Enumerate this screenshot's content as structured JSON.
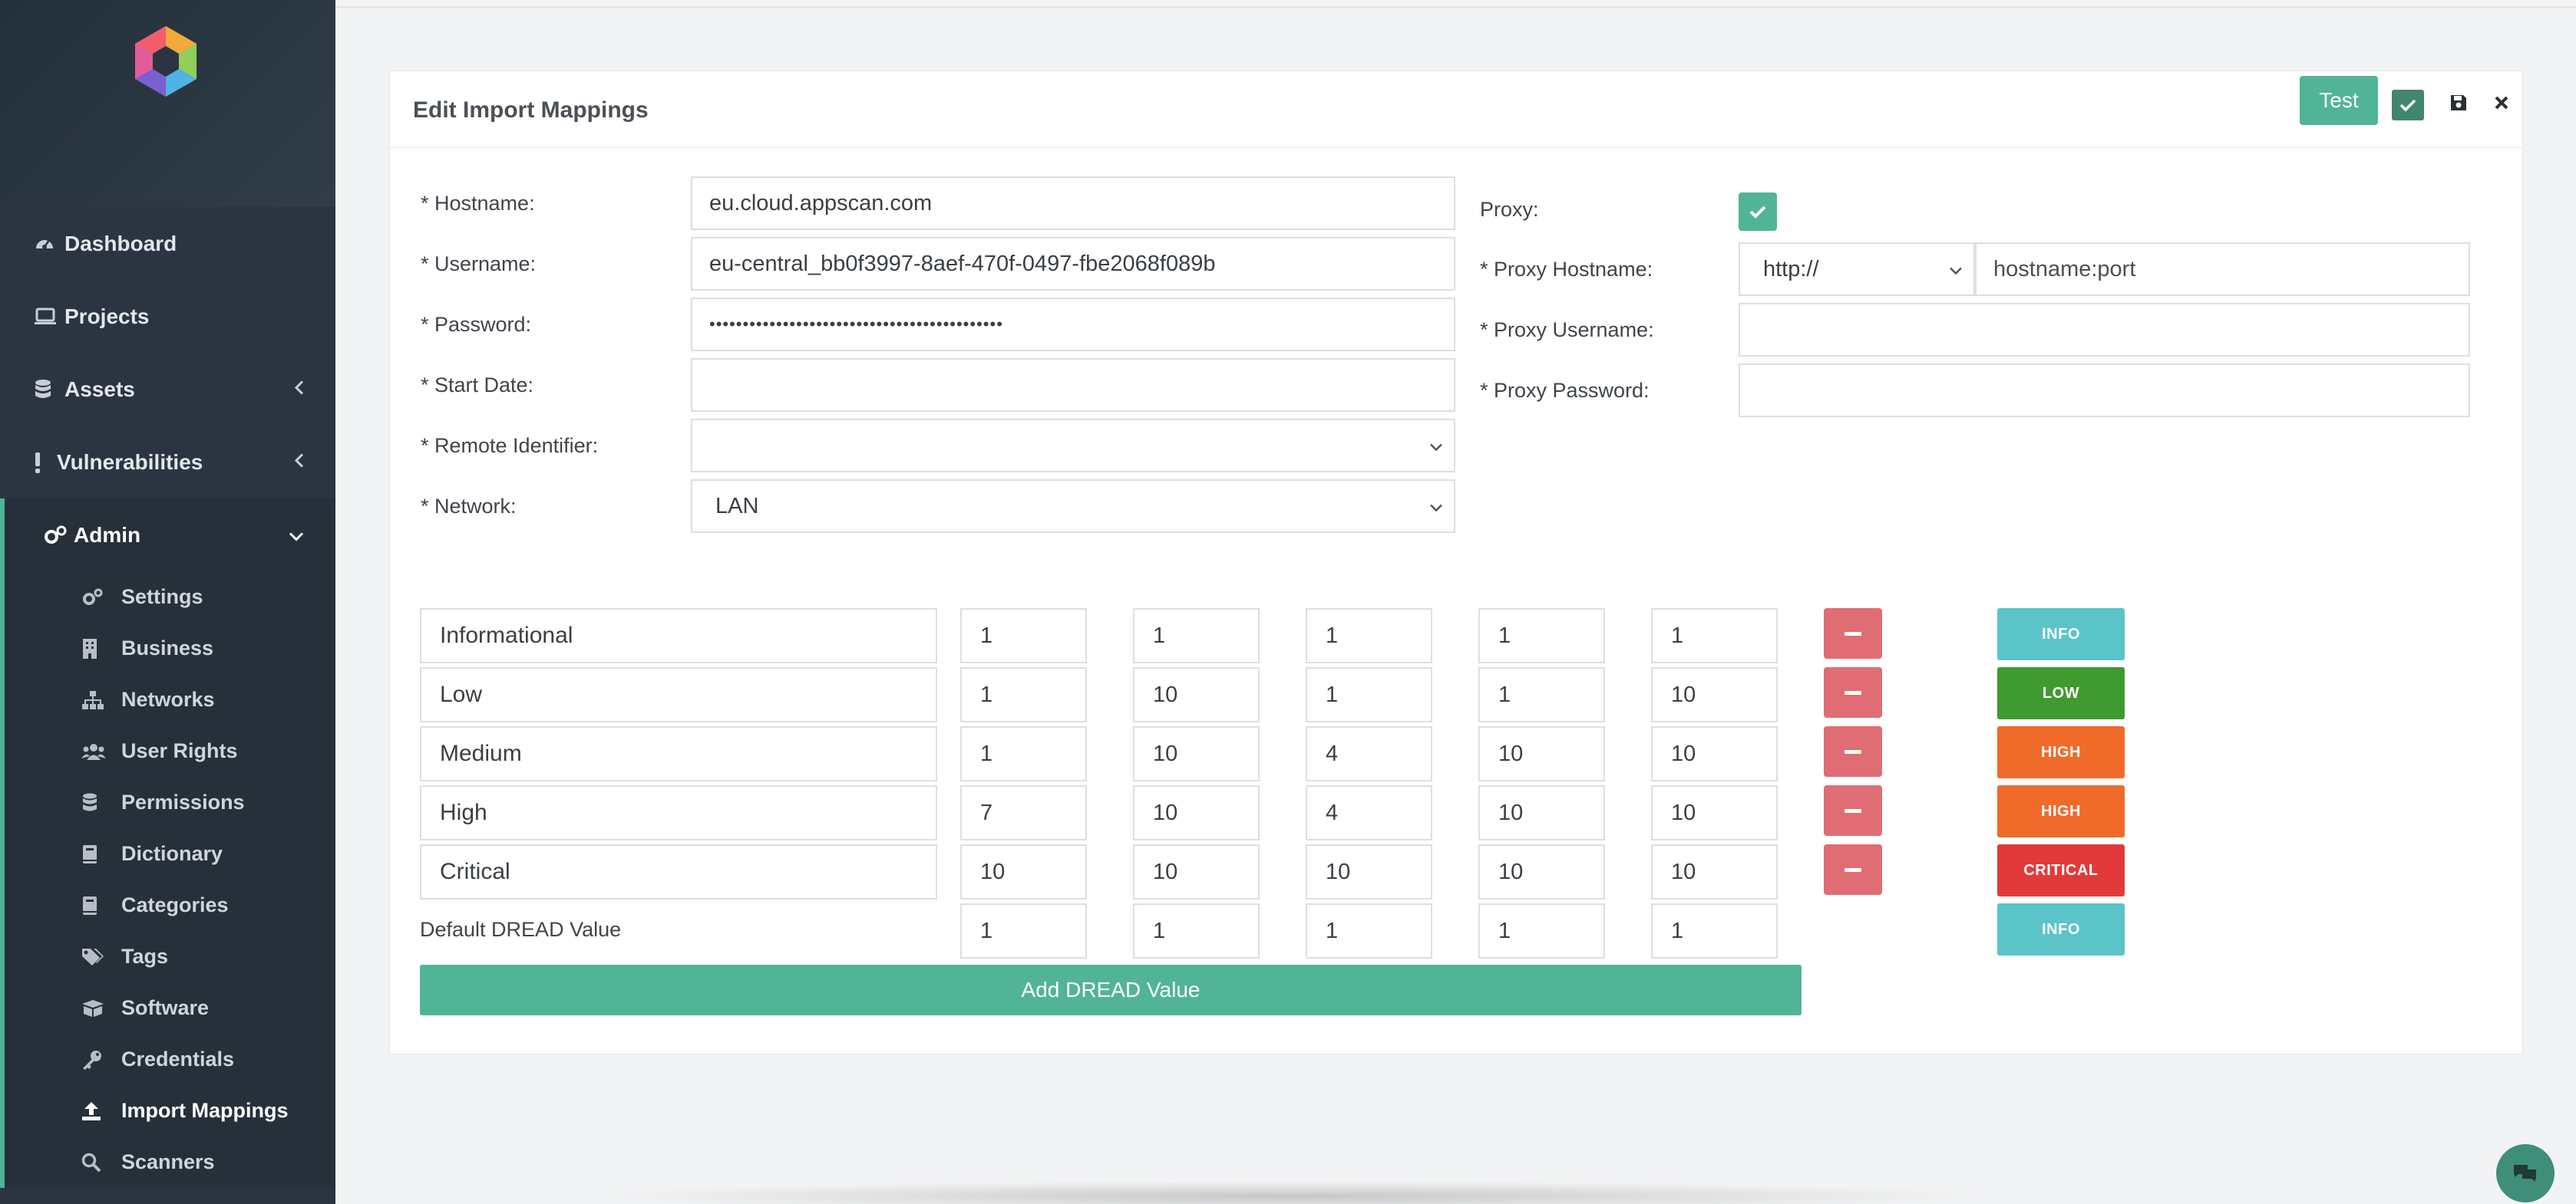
{
  "sidebar": {
    "items": [
      {
        "label": "Dashboard",
        "icon": "dashboard-icon"
      },
      {
        "label": "Projects",
        "icon": "laptop-icon"
      },
      {
        "label": "Assets",
        "icon": "database-icon"
      },
      {
        "label": "Vulnerabilities",
        "icon": "exclamation-icon"
      },
      {
        "label": "Admin",
        "icon": "cogs-icon"
      }
    ],
    "admin_items": [
      {
        "label": "Settings",
        "icon": "cogs-icon"
      },
      {
        "label": "Business",
        "icon": "building-icon"
      },
      {
        "label": "Networks",
        "icon": "sitemap-icon"
      },
      {
        "label": "User Rights",
        "icon": "users-icon"
      },
      {
        "label": "Permissions",
        "icon": "database-icon"
      },
      {
        "label": "Dictionary",
        "icon": "book-icon"
      },
      {
        "label": "Categories",
        "icon": "book-icon"
      },
      {
        "label": "Tags",
        "icon": "tags-icon"
      },
      {
        "label": "Software",
        "icon": "box-icon"
      },
      {
        "label": "Credentials",
        "icon": "key-icon"
      },
      {
        "label": "Import Mappings",
        "icon": "upload-icon"
      },
      {
        "label": "Scanners",
        "icon": "search-icon"
      }
    ]
  },
  "panel": {
    "title": "Edit Import Mappings",
    "test_label": "Test"
  },
  "form": {
    "hostname_label": "* Hostname:",
    "hostname": "eu.cloud.appscan.com",
    "username_label": "* Username:",
    "username": "eu-central_bb0f3997-8aef-470f-0497-fbe2068f089b",
    "password_label": "* Password:",
    "password": "••••••••••••••••••••••••••••••••••••••••••••",
    "start_date_label": "* Start Date:",
    "start_date": "",
    "remote_identifier_label": "* Remote Identifier:",
    "remote_identifier": "",
    "network_label": "* Network:",
    "network": "LAN",
    "proxy_label": "Proxy:",
    "proxy_enabled": true,
    "proxy_hostname_label": "* Proxy Hostname:",
    "proxy_scheme": "http://",
    "proxy_hostname_placeholder": "hostname:port",
    "proxy_username_label": "* Proxy Username:",
    "proxy_username": "",
    "proxy_password_label": "* Proxy Password:",
    "proxy_password": ""
  },
  "dread": {
    "rows": [
      {
        "name": "Informational",
        "values": [
          "1",
          "1",
          "1",
          "1",
          "1"
        ],
        "badge": "INFO",
        "badge_color": "#5bc4c9"
      },
      {
        "name": "Low",
        "values": [
          "1",
          "10",
          "1",
          "1",
          "10"
        ],
        "badge": "LOW",
        "badge_color": "#3f9a2f"
      },
      {
        "name": "Medium",
        "values": [
          "1",
          "10",
          "4",
          "10",
          "10"
        ],
        "badge": "HIGH",
        "badge_color": "#f06a2a"
      },
      {
        "name": "High",
        "values": [
          "7",
          "10",
          "4",
          "10",
          "10"
        ],
        "badge": "HIGH",
        "badge_color": "#f06a2a"
      },
      {
        "name": "Critical",
        "values": [
          "10",
          "10",
          "10",
          "10",
          "10"
        ],
        "badge": "CRITICAL",
        "badge_color": "#e23a3a"
      }
    ],
    "default_label": "Default DREAD Value",
    "default_values": [
      "1",
      "1",
      "1",
      "1",
      "1"
    ],
    "default_badge": "INFO",
    "default_badge_color": "#5bc4c9",
    "add_label": "Add DREAD Value"
  }
}
